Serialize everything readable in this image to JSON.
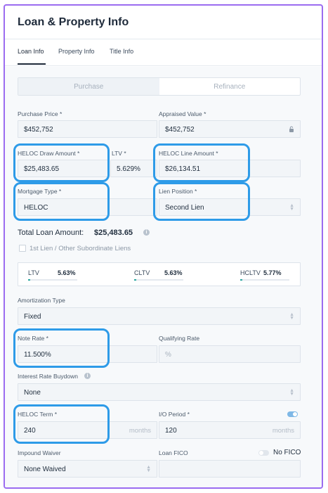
{
  "header": {
    "title": "Loan & Property Info"
  },
  "tabs": [
    {
      "label": "Loan Info",
      "active": true
    },
    {
      "label": "Property Info",
      "active": false
    },
    {
      "label": "Title Info",
      "active": false
    }
  ],
  "purpose_toggle": {
    "options": [
      "Purchase",
      "Refinance"
    ]
  },
  "fields": {
    "purchase_price": {
      "label": "Purchase Price *",
      "value": "$452,752"
    },
    "appraised_value": {
      "label": "Appraised Value *",
      "value": "$452,752"
    },
    "heloc_draw_amount": {
      "label": "HELOC Draw Amount *",
      "value": "$25,483.65"
    },
    "ltv": {
      "label": "LTV *",
      "value": "5.629%"
    },
    "heloc_line_amount": {
      "label": "HELOC Line Amount *",
      "value": "$26,134.51"
    },
    "mortgage_type": {
      "label": "Mortgage Type *",
      "value": "HELOC"
    },
    "lien_position": {
      "label": "Lien Position *",
      "value": "Second Lien"
    },
    "amortization_type": {
      "label": "Amortization Type",
      "value": "Fixed"
    },
    "note_rate": {
      "label": "Note Rate *",
      "value": "11.500%"
    },
    "qualifying_rate": {
      "label": "Qualifying Rate",
      "placeholder": "%"
    },
    "interest_rate_buydown": {
      "label": "Interest Rate Buydown",
      "value": "None"
    },
    "heloc_term": {
      "label": "HELOC Term *",
      "value": "240",
      "unit": "months"
    },
    "io_period": {
      "label": "I/O Period *",
      "value": "120",
      "unit": "months"
    },
    "impound_waiver": {
      "label": "Impound Waiver",
      "value": "None Waived"
    },
    "loan_fico": {
      "label": "Loan FICO",
      "value": ""
    }
  },
  "total_loan": {
    "label": "Total Loan Amount:",
    "value": "$25,483.65"
  },
  "subordinate_checkbox": {
    "label": "1st Lien / Other Subordinate Liens",
    "checked": false
  },
  "ratios": [
    {
      "label": "LTV",
      "value": "5.63%",
      "fraction": 0.0563
    },
    {
      "label": "CLTV",
      "value": "5.63%",
      "fraction": 0.0563
    },
    {
      "label": "HCLTV",
      "value": "5.77%",
      "fraction": 0.0577
    }
  ],
  "io_toggle": {
    "on": true
  },
  "no_fico": {
    "label": "No FICO",
    "on": false
  },
  "colors": {
    "highlight": "#2e9be8",
    "frame": "#9b6cf0",
    "accent": "#2aa7a0",
    "toggle_on": "#7fb8e6"
  }
}
